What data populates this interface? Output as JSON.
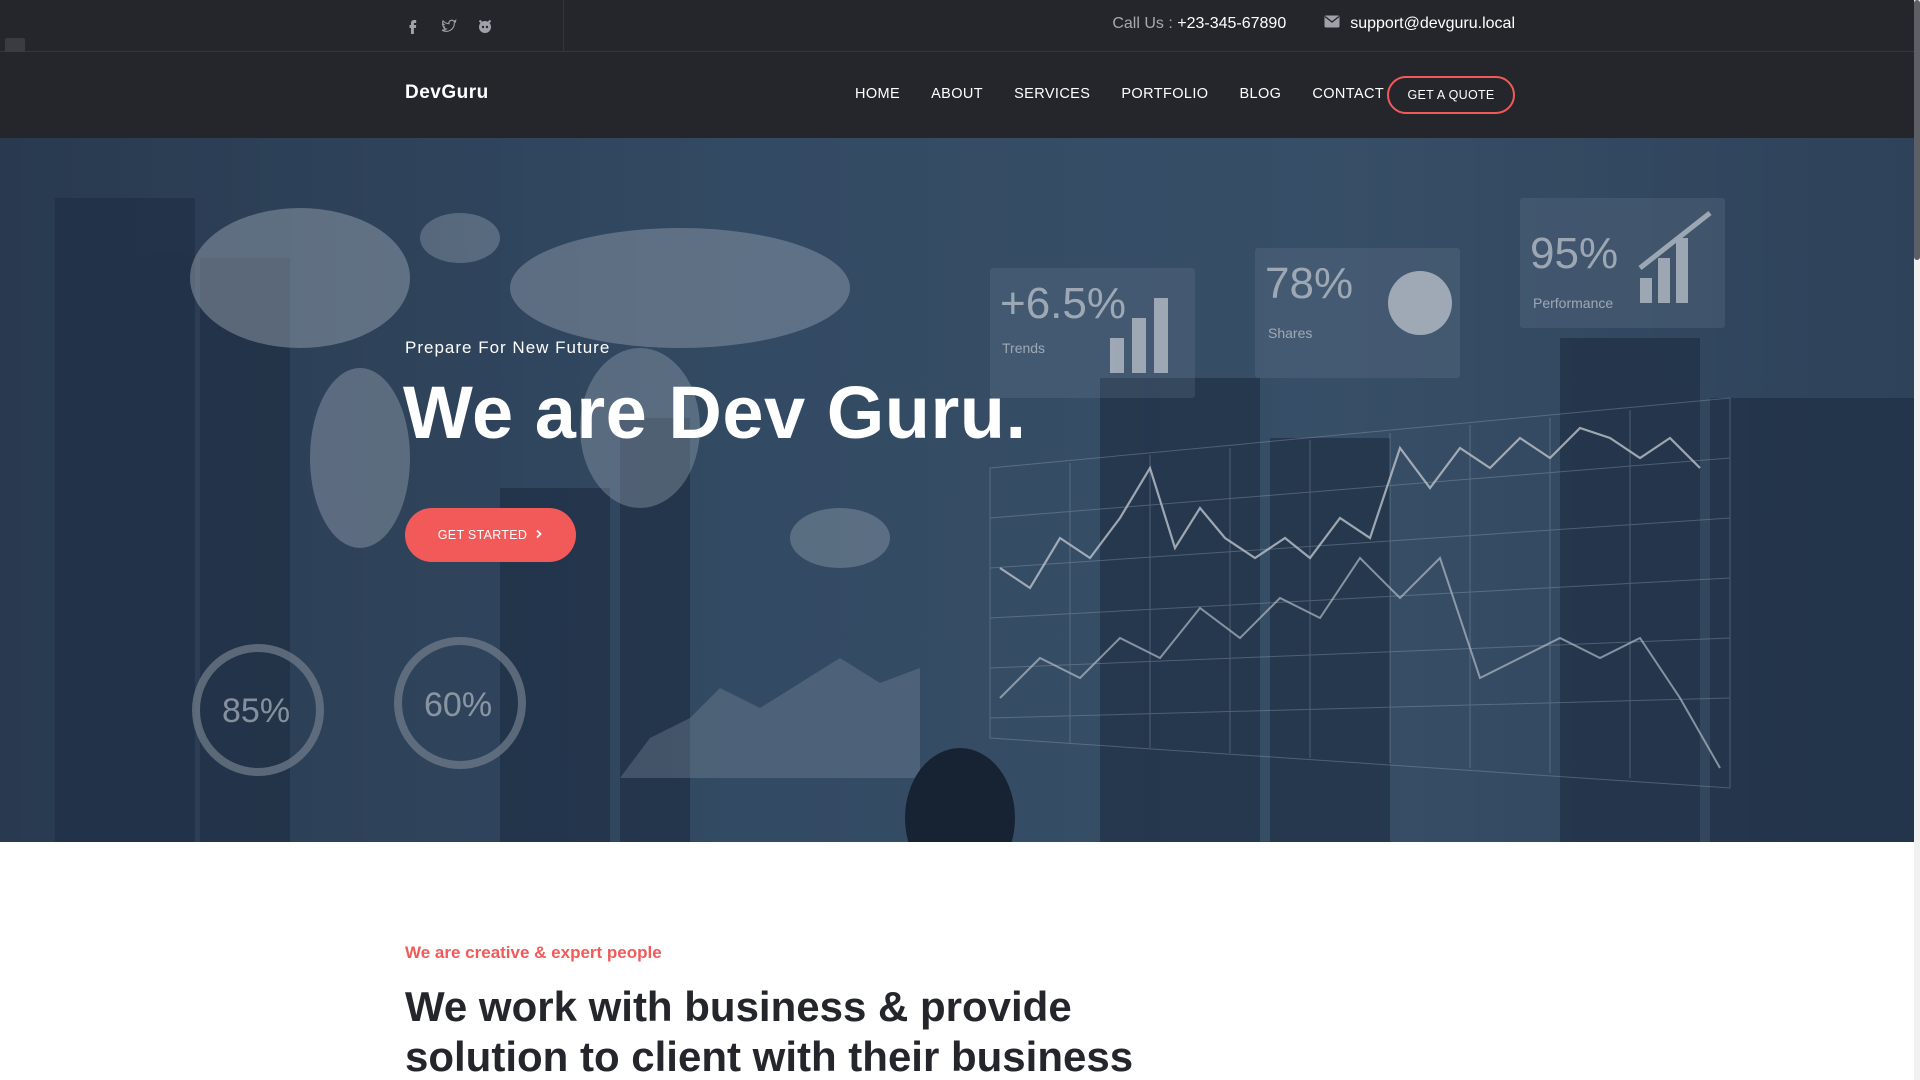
{
  "topbar": {
    "social": [
      {
        "icon": "facebook-icon"
      },
      {
        "icon": "twitter-icon"
      },
      {
        "icon": "github-icon"
      }
    ],
    "call_label": "Call Us :",
    "phone": "+23-345-67890",
    "email_icon": "envelope-icon",
    "email": "support@devguru.local"
  },
  "nav": {
    "logo": "DevGuru",
    "items": [
      "HOME",
      "ABOUT",
      "SERVICES",
      "PORTFOLIO",
      "BLOG",
      "CONTACT"
    ],
    "quote_label": "GET A QUOTE"
  },
  "hero": {
    "subtitle": "Prepare For New Future",
    "title": "We are Dev Guru.",
    "cta_label": "GET STARTED",
    "cta_icon": "chevron-right-icon",
    "image_text": {
      "trends_value": "+6.5%",
      "trends_label": "Trends",
      "shares_value": "78%",
      "shares_label": "Shares",
      "performance_value": "95%",
      "performance_label": "Performance",
      "ring1": "85%",
      "ring2": "60%"
    }
  },
  "about": {
    "kicker": "We are creative & expert people",
    "heading": "We work with business & provide solution to client with their business"
  },
  "colors": {
    "accent": "#f25a5a",
    "dark": "#24262b"
  }
}
